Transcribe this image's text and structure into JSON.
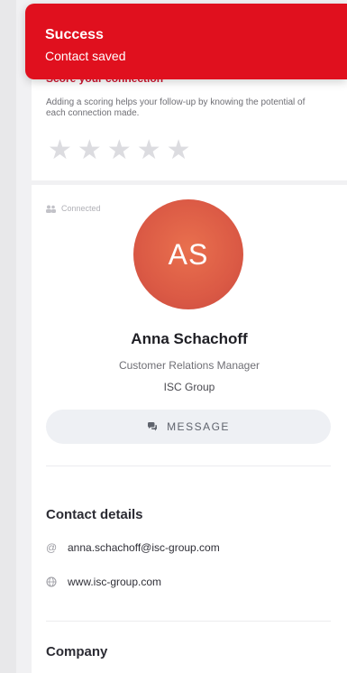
{
  "toast": {
    "title": "Success",
    "message": "Contact saved"
  },
  "scoring": {
    "title": "Score your connection",
    "description": "Adding a scoring helps your follow-up by knowing the potential of each connection made.",
    "rating": 0,
    "max_rating": 5,
    "star_glyph": "★"
  },
  "profile": {
    "status": "Connected",
    "initials": "AS",
    "name": "Anna Schachoff",
    "job_title": "Customer Relations Manager",
    "company": "ISC Group",
    "message_button": "MESSAGE"
  },
  "contact_details": {
    "title": "Contact details",
    "email_icon": "@",
    "email": "anna.schachoff@isc-group.com",
    "website": "www.isc-group.com"
  },
  "company_section": {
    "title": "Company"
  },
  "colors": {
    "accent": "#e0101e",
    "avatar": "#e1604a",
    "star_empty": "#dcdce0"
  }
}
